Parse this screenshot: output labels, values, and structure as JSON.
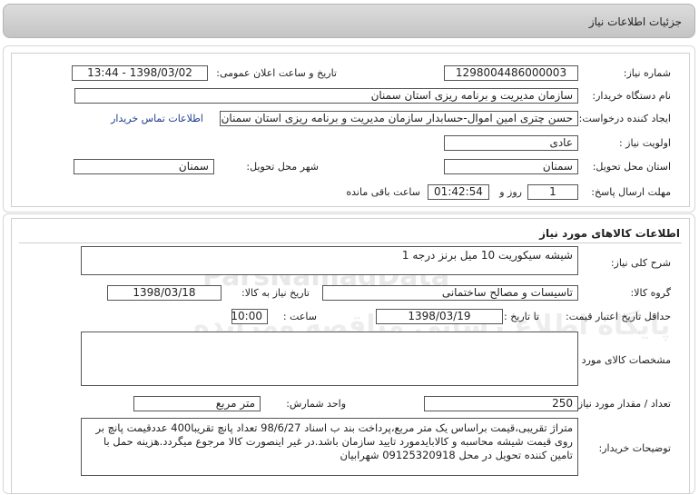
{
  "header": {
    "title": "جزئیات اطلاعات نیاز"
  },
  "need_info": {
    "need_number_label": "شماره نیاز:",
    "need_number": "1298004486000003",
    "announce_label": "تاریخ و ساعت اعلان عمومی:",
    "announce_value": "1398/03/02 - 13:44",
    "buyer_org_label": "نام دستگاه خریدار:",
    "buyer_org": "سازمان مدیریت و برنامه ریزی استان سمنان",
    "requester_label": "ایجاد کننده درخواست:",
    "requester": "حسن چتری امین اموال-حسابدار سازمان مدیریت و برنامه ریزی استان سمنان",
    "contact_link": "اطلاعات تماس خریدار",
    "priority_label": "اولویت نیاز :",
    "priority": "عادی",
    "province_label": "استان محل تحویل:",
    "province": "سمنان",
    "city_label": "شهر محل تحویل:",
    "city": "سمنان",
    "deadline_label": "مهلت ارسال پاسخ:",
    "deadline_days": "1",
    "days_word": "روز و",
    "deadline_time": "01:42:54",
    "remaining_word": "ساعت باقی مانده"
  },
  "goods": {
    "section_title": "اطلاعات کالاهای مورد نیاز",
    "general_desc_label": "شرح کلی نیاز:",
    "general_desc": "شیشه سیکوریت 10 میل برنز درجه 1",
    "group_label": "گروه کالا:",
    "group": "تاسیسات و مصالح ساختمانی",
    "need_date_label": "تاریخ نیاز به کالا:",
    "need_date": "1398/03/18",
    "validity_label": "حداقل تاریخ اعتبار قیمت:",
    "until_date_label": "تا تاریخ :",
    "until_date": "1398/03/19",
    "hour_label": "ساعت :",
    "hour": "10:00",
    "specs_label": "مشخصات کالای مورد نیاز:",
    "specs": "",
    "qty_label": "تعداد / مقدار مورد نیاز:",
    "qty": "250",
    "unit_label": "واحد شمارش:",
    "unit": "متر مربع",
    "buyer_notes_label": "توضیحات خریدار:",
    "buyer_notes": "متراژ تقریبی،قیمت براساس یک متر مربع،پرداخت بند ب اسناد 98/6/27 تعداد پانچ تقریبا400 عددقیمت پانچ بر روی قیمت شیشه محاسبه و کالابایدمورد تایید سازمان باشد.در غیر اینصورت کالا مرجوع میگردد.هزینه حمل با تامین کننده تحویل در محل 09125320918 شهرابیان"
  }
}
